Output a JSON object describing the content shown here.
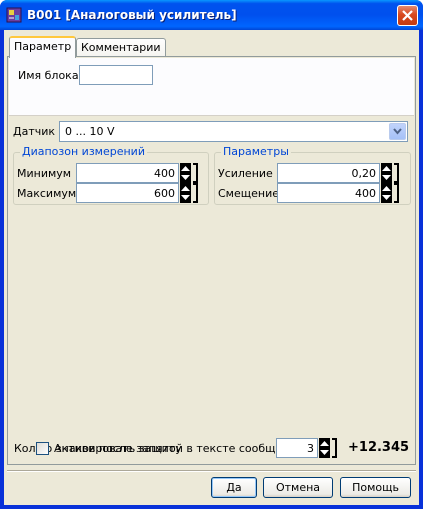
{
  "window": {
    "title": "B001 [Аналоговый усилитель]"
  },
  "tabs": [
    {
      "label": "Параметр",
      "active": true
    },
    {
      "label": "Комментарии",
      "active": false
    }
  ],
  "block_name": {
    "label": "Имя блока",
    "value": ""
  },
  "sensor": {
    "label": "Датчик",
    "value": "0 ... 10 V"
  },
  "range_group": {
    "title": "Диапозон измерений",
    "min": {
      "label": "Минимум",
      "value": "400"
    },
    "max": {
      "label": "Максимум",
      "value": "600"
    }
  },
  "params_group": {
    "title": "Параметры",
    "gain": {
      "label": "Усиление",
      "value": "0,20"
    },
    "offset": {
      "label": "Смещение",
      "value": "400"
    }
  },
  "decimals": {
    "label": "Кол.во знаков после запятой в тексте сообщения.",
    "value": "3",
    "preview": "+12.345"
  },
  "protection": {
    "label": "Активировать защиту",
    "checked": false
  },
  "buttons": {
    "ok": "Да",
    "cancel": "Отмена",
    "help": "Помощь"
  },
  "colors": {
    "group_title": "#0046d5",
    "title_bar": "#0053ee",
    "close": "#d8491f"
  },
  "icons": {
    "window": "block-app-icon",
    "close": "close-icon",
    "spin": "spin-arrows-icon",
    "dropdown": "chevron-down-icon"
  }
}
